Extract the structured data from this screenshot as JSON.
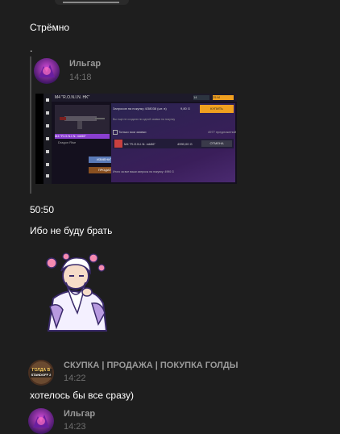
{
  "messages": {
    "m1_text": "Стрёмно",
    "m2_text": ".",
    "reply1": {
      "author": "Ильгар",
      "time": "14:18",
      "screenshot": {
        "item_title": "M4 \"R.O.N.I.N. HK\"",
        "item_name": "M4 \"R.O.N.I.N. mk56\"",
        "subtitle": "Dragon Rise",
        "btn_modify": "ИЗМЕНИТЬ",
        "btn_sell": "ПРОДАТЬ",
        "order_label": "Запросов на покупку 4/38038 (шт. в)",
        "price_top": "9,80 G",
        "btn_buy": "КУПИТЬ",
        "hint": "Вы еще не создали ни одной заявки на покупку",
        "checkbox_label": "Только мои заявки",
        "stat_label": "4977 предложений",
        "row_item": "M4 \"R.O.N.I.N. mk56\"",
        "row_price": "4990,00 G",
        "btn_cancel": "ОТМЕНА",
        "footer_note": "Итого за все ваши запросы на покупку: 4990 G",
        "balance": "25 M",
        "counter": "14"
      }
    },
    "m3_text": "50:50",
    "m4_text": "Ибо не буду брать",
    "reply2": {
      "author": "СКУПКА | ПРОДАЖА | ПОКУПКА ГОЛДЫ",
      "time": "14:22",
      "avatar_text_top": "ГОЛДА В",
      "avatar_text_bottom": "STANDOFF 2"
    },
    "m5_text": "хотелось бы все сразу)",
    "reply3": {
      "author": "Ильгар",
      "time": "14:23"
    }
  },
  "colors": {
    "background": "#1e1e1e",
    "accent_orange": "#f0a020",
    "accent_purple": "#8a3fd0"
  }
}
